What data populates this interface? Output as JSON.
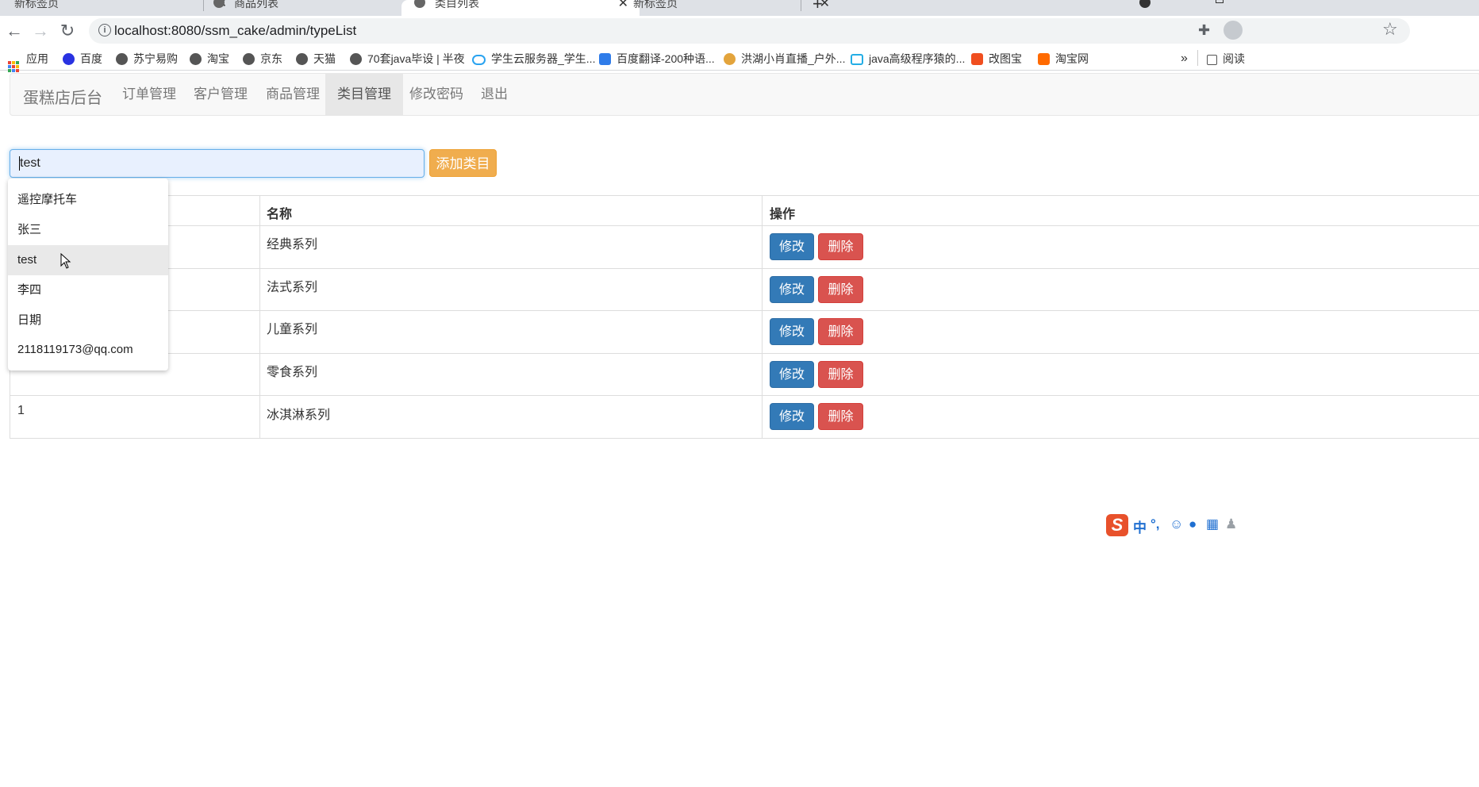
{
  "browser": {
    "tabs": [
      {
        "label": "新标签页",
        "active": false
      },
      {
        "label": "商品列表",
        "active": false
      },
      {
        "label": "类目列表",
        "active": true
      },
      {
        "label": "新标签页",
        "active": false
      }
    ],
    "url": "localhost:8080/ssm_cake/admin/typeList",
    "bookmarks": [
      "应用",
      "百度",
      "苏宁易购",
      "淘宝",
      "京东",
      "天猫",
      "70套java毕设 | 半夜",
      "学生云服务器_学生...",
      "百度翻译-200种语...",
      "洪湖小肖直播_户外...",
      "java高级程序猿的...",
      "改图宝",
      "淘宝网"
    ],
    "bookmarks_more": "»",
    "reading_list": "阅读"
  },
  "navbar": {
    "brand": "蛋糕店后台",
    "items": [
      "订单管理",
      "客户管理",
      "商品管理",
      "类目管理",
      "修改密码",
      "退出"
    ],
    "active": "类目管理"
  },
  "form": {
    "type_input_value": "test",
    "add_button": "添加类目"
  },
  "autocomplete": {
    "items": [
      "遥控摩托车",
      "张三",
      "test",
      "李四",
      "日期",
      "2118119173@qq.com"
    ],
    "highlighted": "test"
  },
  "table": {
    "headers": [
      "",
      "名称",
      "操作"
    ],
    "rows": [
      {
        "id": "",
        "name": "经典系列"
      },
      {
        "id": "",
        "name": "法式系列"
      },
      {
        "id": "",
        "name": "儿童系列"
      },
      {
        "id": "",
        "name": "零食系列"
      },
      {
        "id": "1",
        "name": "冰淇淋系列"
      }
    ],
    "edit_label": "修改",
    "delete_label": "删除"
  },
  "ime": {
    "logo": "S",
    "mode": "中",
    "punct": "°,"
  },
  "colors": {
    "primary": "#337ab7",
    "danger": "#d9534f",
    "warning": "#f0ad4e"
  }
}
